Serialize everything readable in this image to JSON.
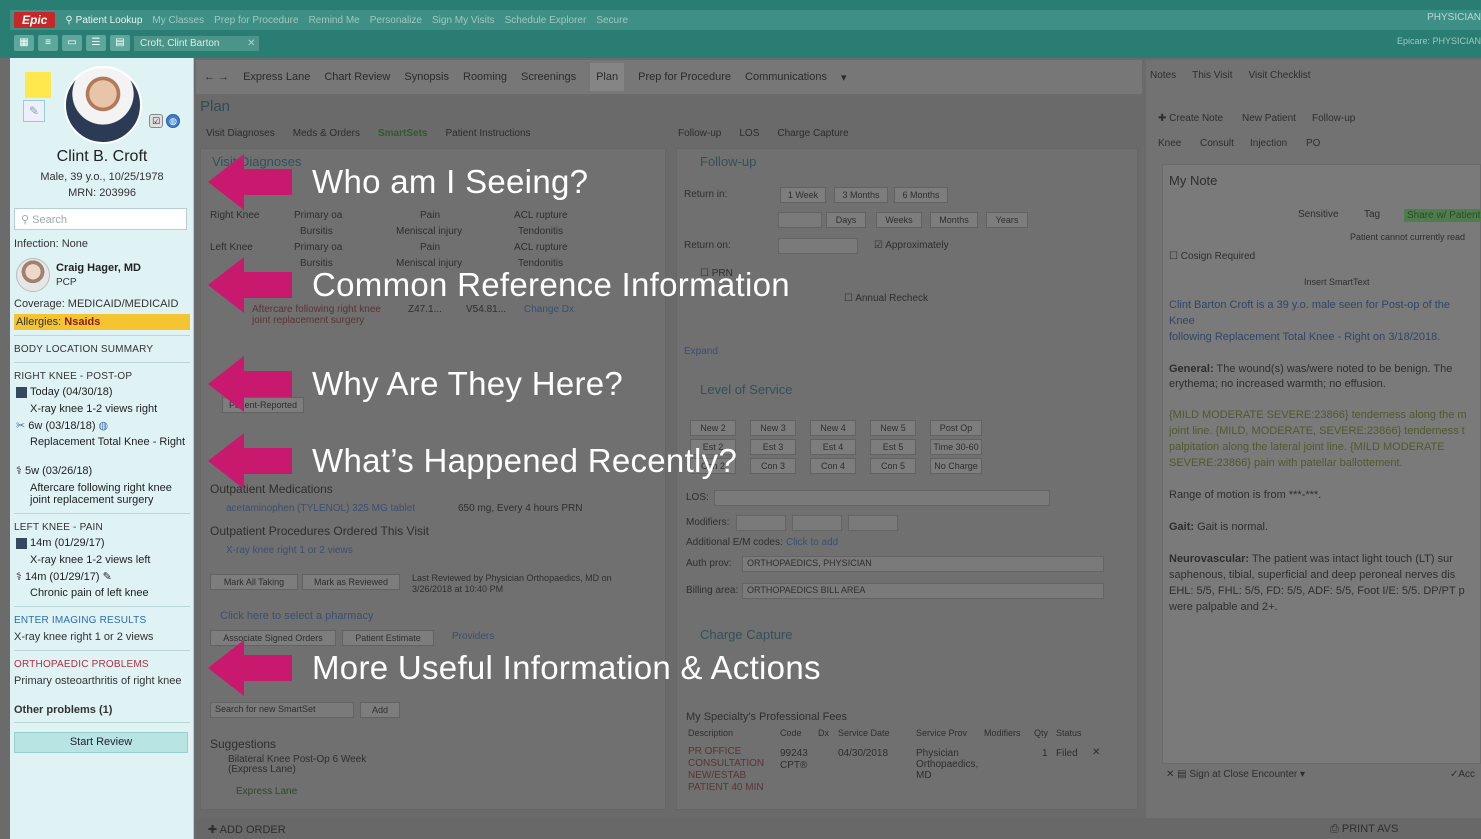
{
  "app": {
    "epic_label": "Epic",
    "menu": [
      "Patient Lookup",
      "My Classes",
      "Prep for Procedure",
      "Remind Me",
      "Personalize",
      "Sign My Visits",
      "Schedule Explorer",
      "Secure"
    ],
    "patient_tab": "Croft, Clint Barton",
    "user": "PHYSICIAN",
    "user_sub": "Epicare: PHYSICIAN"
  },
  "sidebar": {
    "name": "Clint B. Croft",
    "demographics": "Male, 39 y.o., 10/25/1978",
    "mrn": "MRN: 203996",
    "search_placeholder": "Search",
    "infection": "Infection: None",
    "pcp_name": "Craig Hager, MD",
    "pcp_role": "PCP",
    "coverage": "Coverage: MEDICAID/MEDICAID",
    "allergies_label": "Allergies: ",
    "allergies_value": "Nsaids",
    "body_summary": "BODY LOCATION SUMMARY",
    "right_knee": {
      "header": "RIGHT KNEE - POST-OP",
      "item1_date": "Today (04/30/18)",
      "item1_desc": "X-ray knee 1-2 views right",
      "item2_date": "6w (03/18/18)",
      "item2_desc": "Replacement Total Knee - Right",
      "item3_date": "5w (03/26/18)",
      "item3_desc": "Aftercare following right knee joint replacement surgery"
    },
    "left_knee": {
      "header": "LEFT KNEE - PAIN",
      "item1_date": "14m (01/29/17)",
      "item1_desc": "X-ray knee 1-2 views left",
      "item2_date": "14m (01/29/17)",
      "item2_desc": "Chronic pain of left knee"
    },
    "imaging_link": "ENTER IMAGING RESULTS",
    "imaging_desc": "X-ray knee right 1 or 2 views",
    "ortho_link": "ORTHOPAEDIC PROBLEMS",
    "ortho_desc": "Primary osteoarthritis of right knee",
    "other_problems": "Other problems (1)",
    "start_review": "Start Review"
  },
  "activities": [
    "Express Lane",
    "Chart Review",
    "Synopsis",
    "Rooming",
    "Screenings",
    "Plan",
    "Prep for Procedure",
    "Communications"
  ],
  "plan": {
    "title": "Plan",
    "subnav_left": [
      "Visit Diagnoses",
      "Meds & Orders",
      "SmartSets",
      "Patient Instructions"
    ],
    "subnav_mid": [
      "Follow-up",
      "LOS",
      "Charge Capture"
    ],
    "visit_diagnoses": "Visit Diagnoses",
    "dx_rows": [
      [
        "Right Knee",
        "Primary oa",
        "Pain",
        "ACL rupture"
      ],
      [
        "",
        "Bursitis",
        "Meniscal injury",
        "Tendonitis"
      ],
      [
        "Left Knee",
        "Primary oa",
        "Pain",
        "ACL rupture"
      ],
      [
        "",
        "Bursitis",
        "Meniscal injury",
        "Tendonitis"
      ]
    ],
    "aftercare": "Aftercare following right knee joint replacement surgery",
    "aftercare_code1": "Z47.1...",
    "aftercare_code2": "V54.81...",
    "change_dx": "Change Dx",
    "patient_reported": "Patient-Reported",
    "outpatient_meds": "Outpatient Medications",
    "med": "acetaminophen (TYLENOL) 325 MG tablet",
    "med_sig": "650 mg, Every 4 hours PRN",
    "procedures": "Outpatient Procedures Ordered This Visit",
    "procedure": "X-ray knee right 1 or 2 views",
    "mark_all_taking": "Mark All Taking",
    "mark_reviewed": "Mark as Reviewed",
    "last_reviewed": "Last Reviewed by Physician Orthopaedics, MD on 3/26/2018 at 10:40 PM",
    "pharmacy": "Click here to select a pharmacy",
    "associate": "Associate Signed Orders",
    "estimate": "Patient Estimate",
    "providers": "Providers",
    "smartset_search": "Search for new SmartSet",
    "add": "Add",
    "suggestions": "Suggestions",
    "suggestion1": "Bilateral Knee Post-Op 6 Week (Express Lane)",
    "express_lane": "Express Lane",
    "followup": "Follow-up",
    "return_in": "Return in:",
    "return_opts": [
      "1 Week",
      "3 Months",
      "6 Months"
    ],
    "units": [
      "Days",
      "Weeks",
      "Months",
      "Years"
    ],
    "return_on": "Return on:",
    "approximately": "Approximately",
    "prn": "PRN",
    "annual_recheck": "Annual Recheck",
    "expand": "Expand",
    "los_title": "Level of Service",
    "los_row1": [
      "New 2",
      "New 3",
      "New 4",
      "New 5",
      "Post Op"
    ],
    "los_row2": [
      "Est 2",
      "Est 3",
      "Est 4",
      "Est 5",
      "Time 30-60"
    ],
    "los_row3": [
      "Con 2",
      "Con 3",
      "Con 4",
      "Con 5",
      "No Charge"
    ],
    "los_label": "LOS:",
    "modifiers": "Modifiers:",
    "additional_em": "Additional E/M codes:",
    "click_to_add": "Click to add",
    "auth_prov_label": "Auth prov:",
    "auth_prov": "ORTHOPAEDICS, PHYSICIAN",
    "billing_label": "Billing area:",
    "billing": "ORTHOPAEDICS BILL AREA",
    "charge_capture": "Charge Capture",
    "fees_title": "My Specialty's Professional Fees",
    "fee_headers": [
      "Description",
      "Code",
      "Dx",
      "Service Date",
      "Service Prov",
      "Modifiers",
      "Qty",
      "Status"
    ],
    "fee_desc": "PR OFFICE CONSULTATION NEW/ESTAB PATIENT 40 MIN",
    "fee_code": "99243",
    "fee_code_type": "CPT®",
    "fee_date": "04/30/2018",
    "fee_prov": "Physician Orthopaedics, MD",
    "fee_qty": "1",
    "fee_status": "Filed",
    "add_order": "ADD ORDER",
    "print_avs": "PRINT AVS"
  },
  "notes": {
    "tabs": [
      "Notes",
      "This Visit",
      "Visit Checklist"
    ],
    "actions": [
      "Create Note",
      "New Patient",
      "Follow-up"
    ],
    "actions2": [
      "Knee",
      "Consult",
      "Injection",
      "PO"
    ],
    "title": "My Note",
    "sensitive": "Sensitive",
    "tag": "Tag",
    "share": "Share w/ Patient",
    "cannot_read": "Patient cannot currently read",
    "cosign": "Cosign Required",
    "insert_smarttext": "Insert SmartText",
    "line1": "Clint Barton Croft is a 39 y.o. male seen for Post-op of the",
    "line2": "Knee",
    "line3": " following Replacement Total Knee - Right on 3/18/2018.",
    "general_label": "General:",
    "general_text": " The wound(s) was/were noted to be benign. The",
    "general_text2": "erythema; no increased warmth; no effusion.",
    "sev1": "{MILD MODERATE SEVERE:23866} tenderness along the m",
    "sev2": "joint line. {MILD, MODERATE, SEVERE:23866} tenderness t",
    "sev3": "palpitation along the lateral joint line. {MILD MODERATE",
    "sev4": "SEVERE:23866} pain with patellar ballottement.",
    "rom": "Range of motion is from ***-***.",
    "gait_label": "Gait:",
    "gait_text": " Gait is normal.",
    "neuro_label": "Neurovascular:",
    "neuro1": " The patient was intact light touch (LT) sur",
    "neuro2": "saphenous, tibial, superficial and deep peroneal nerves dis",
    "neuro3": "EHL: 5/5, FHL: 5/5, FD: 5/5, ADF: 5/5, Foot I/E: 5/5. DP/PT p",
    "neuro4": "were palpable and 2+.",
    "sign_close": "Sign at Close Encounter",
    "accept": "Acc"
  },
  "callouts": [
    "Who am I Seeing?",
    "Common Reference Information",
    "Why Are They Here?",
    "What’s Happened Recently?",
    "More Useful Information & Actions"
  ],
  "colors": {
    "accent_magenta": "#c8196e",
    "sidebar_bg": "#dff2f4",
    "allergy_bg": "#f5c431",
    "topbar": "#2a7d73"
  }
}
